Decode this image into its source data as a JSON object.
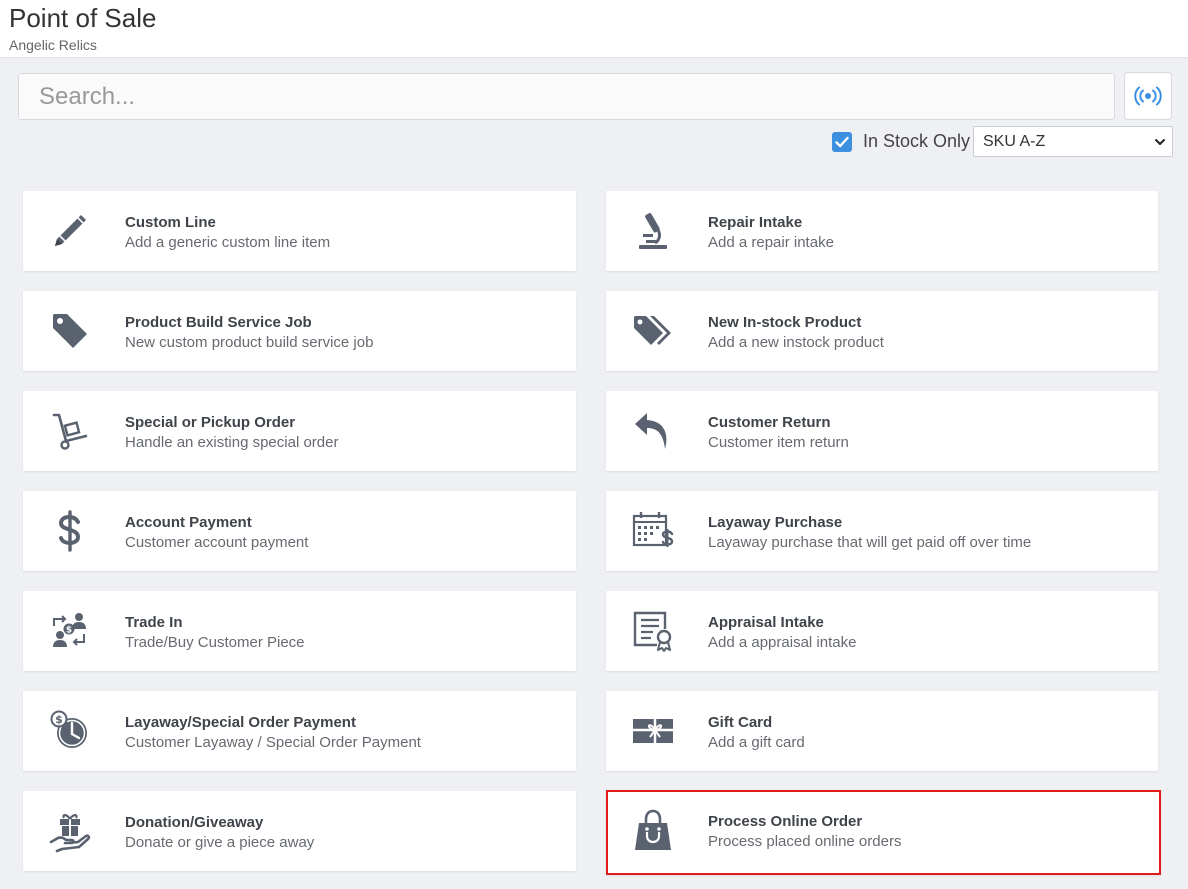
{
  "header": {
    "title": "Point of Sale",
    "subtitle": "Angelic Relics"
  },
  "search": {
    "placeholder": "Search..."
  },
  "filters": {
    "in_stock_label": "In Stock Only",
    "in_stock_checked": true,
    "sort_value": "SKU A-Z"
  },
  "colors": {
    "icon": "#5a6270",
    "accent": "#3d8fe0",
    "highlight": "#e11b1b"
  },
  "cards": [
    {
      "title": "Custom Line",
      "desc": "Add a generic custom line item",
      "icon": "pencil-icon"
    },
    {
      "title": "Repair Intake",
      "desc": "Add a repair intake",
      "icon": "microscope-icon"
    },
    {
      "title": "Product Build Service Job",
      "desc": "New custom product build service job",
      "icon": "tag-icon"
    },
    {
      "title": "New In-stock Product",
      "desc": "Add a new instock product",
      "icon": "tags-icon"
    },
    {
      "title": "Special or Pickup Order",
      "desc": "Handle an existing special order",
      "icon": "hand-truck-icon"
    },
    {
      "title": "Customer Return",
      "desc": "Customer item return",
      "icon": "reply-arrow-icon"
    },
    {
      "title": "Account Payment",
      "desc": "Customer account payment",
      "icon": "dollar-icon"
    },
    {
      "title": "Layaway Purchase",
      "desc": "Layaway purchase that will get paid off over time",
      "icon": "calendar-dollar-icon"
    },
    {
      "title": "Trade In",
      "desc": "Trade/Buy Customer Piece",
      "icon": "trade-exchange-icon"
    },
    {
      "title": "Appraisal Intake",
      "desc": "Add a appraisal intake",
      "icon": "certificate-icon"
    },
    {
      "title": "Layaway/Special Order Payment",
      "desc": "Customer Layaway / Special Order Payment",
      "icon": "clock-dollar-icon"
    },
    {
      "title": "Gift Card",
      "desc": "Add a gift card",
      "icon": "gift-card-icon"
    },
    {
      "title": "Donation/Giveaway",
      "desc": "Donate or give a piece away",
      "icon": "hand-gift-icon"
    },
    {
      "title": "Process Online Order",
      "desc": "Process placed online orders",
      "icon": "shopping-bag-icon",
      "highlighted": true
    }
  ]
}
